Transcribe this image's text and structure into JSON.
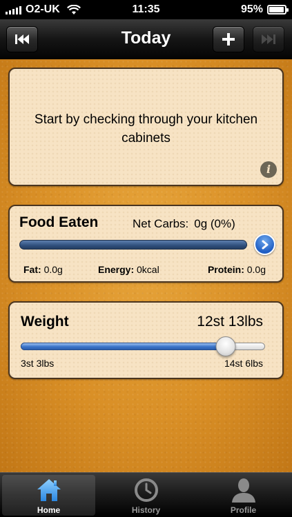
{
  "status_bar": {
    "carrier": "O2-UK",
    "time": "11:35",
    "battery": "95%",
    "battery_level": 0.95
  },
  "nav": {
    "title": "Today",
    "left_icon": "skip-back-icon",
    "add_icon": "plus-icon",
    "right_icon": "skip-forward-icon"
  },
  "tip": {
    "text": "Start by checking through your kitchen cabinets",
    "info_icon": "i"
  },
  "food": {
    "title": "Food Eaten",
    "net_carbs_label": "Net Carbs:",
    "net_carbs_value": "0g (0%)",
    "fat_label": "Fat:",
    "fat_value": "0.0g",
    "energy_label": "Energy:",
    "energy_value": "0kcal",
    "protein_label": "Protein:",
    "protein_value": "0.0g"
  },
  "weight": {
    "title": "Weight",
    "value": "12st 13lbs",
    "min_label": "3st 3lbs",
    "max_label": "14st 6lbs",
    "slider_fraction": 0.84
  },
  "tabs": [
    {
      "label": "Home",
      "icon": "home-icon",
      "selected": true
    },
    {
      "label": "History",
      "icon": "clock-icon",
      "selected": false
    },
    {
      "label": "Profile",
      "icon": "person-icon",
      "selected": false
    }
  ],
  "colors": {
    "card_bg": "#f7e3c4",
    "cork": "#d98f26",
    "food_bar": "#2f4f7c",
    "slider_fill": "#3a74c9",
    "tab_selected_icon": "#4aa6f0"
  }
}
